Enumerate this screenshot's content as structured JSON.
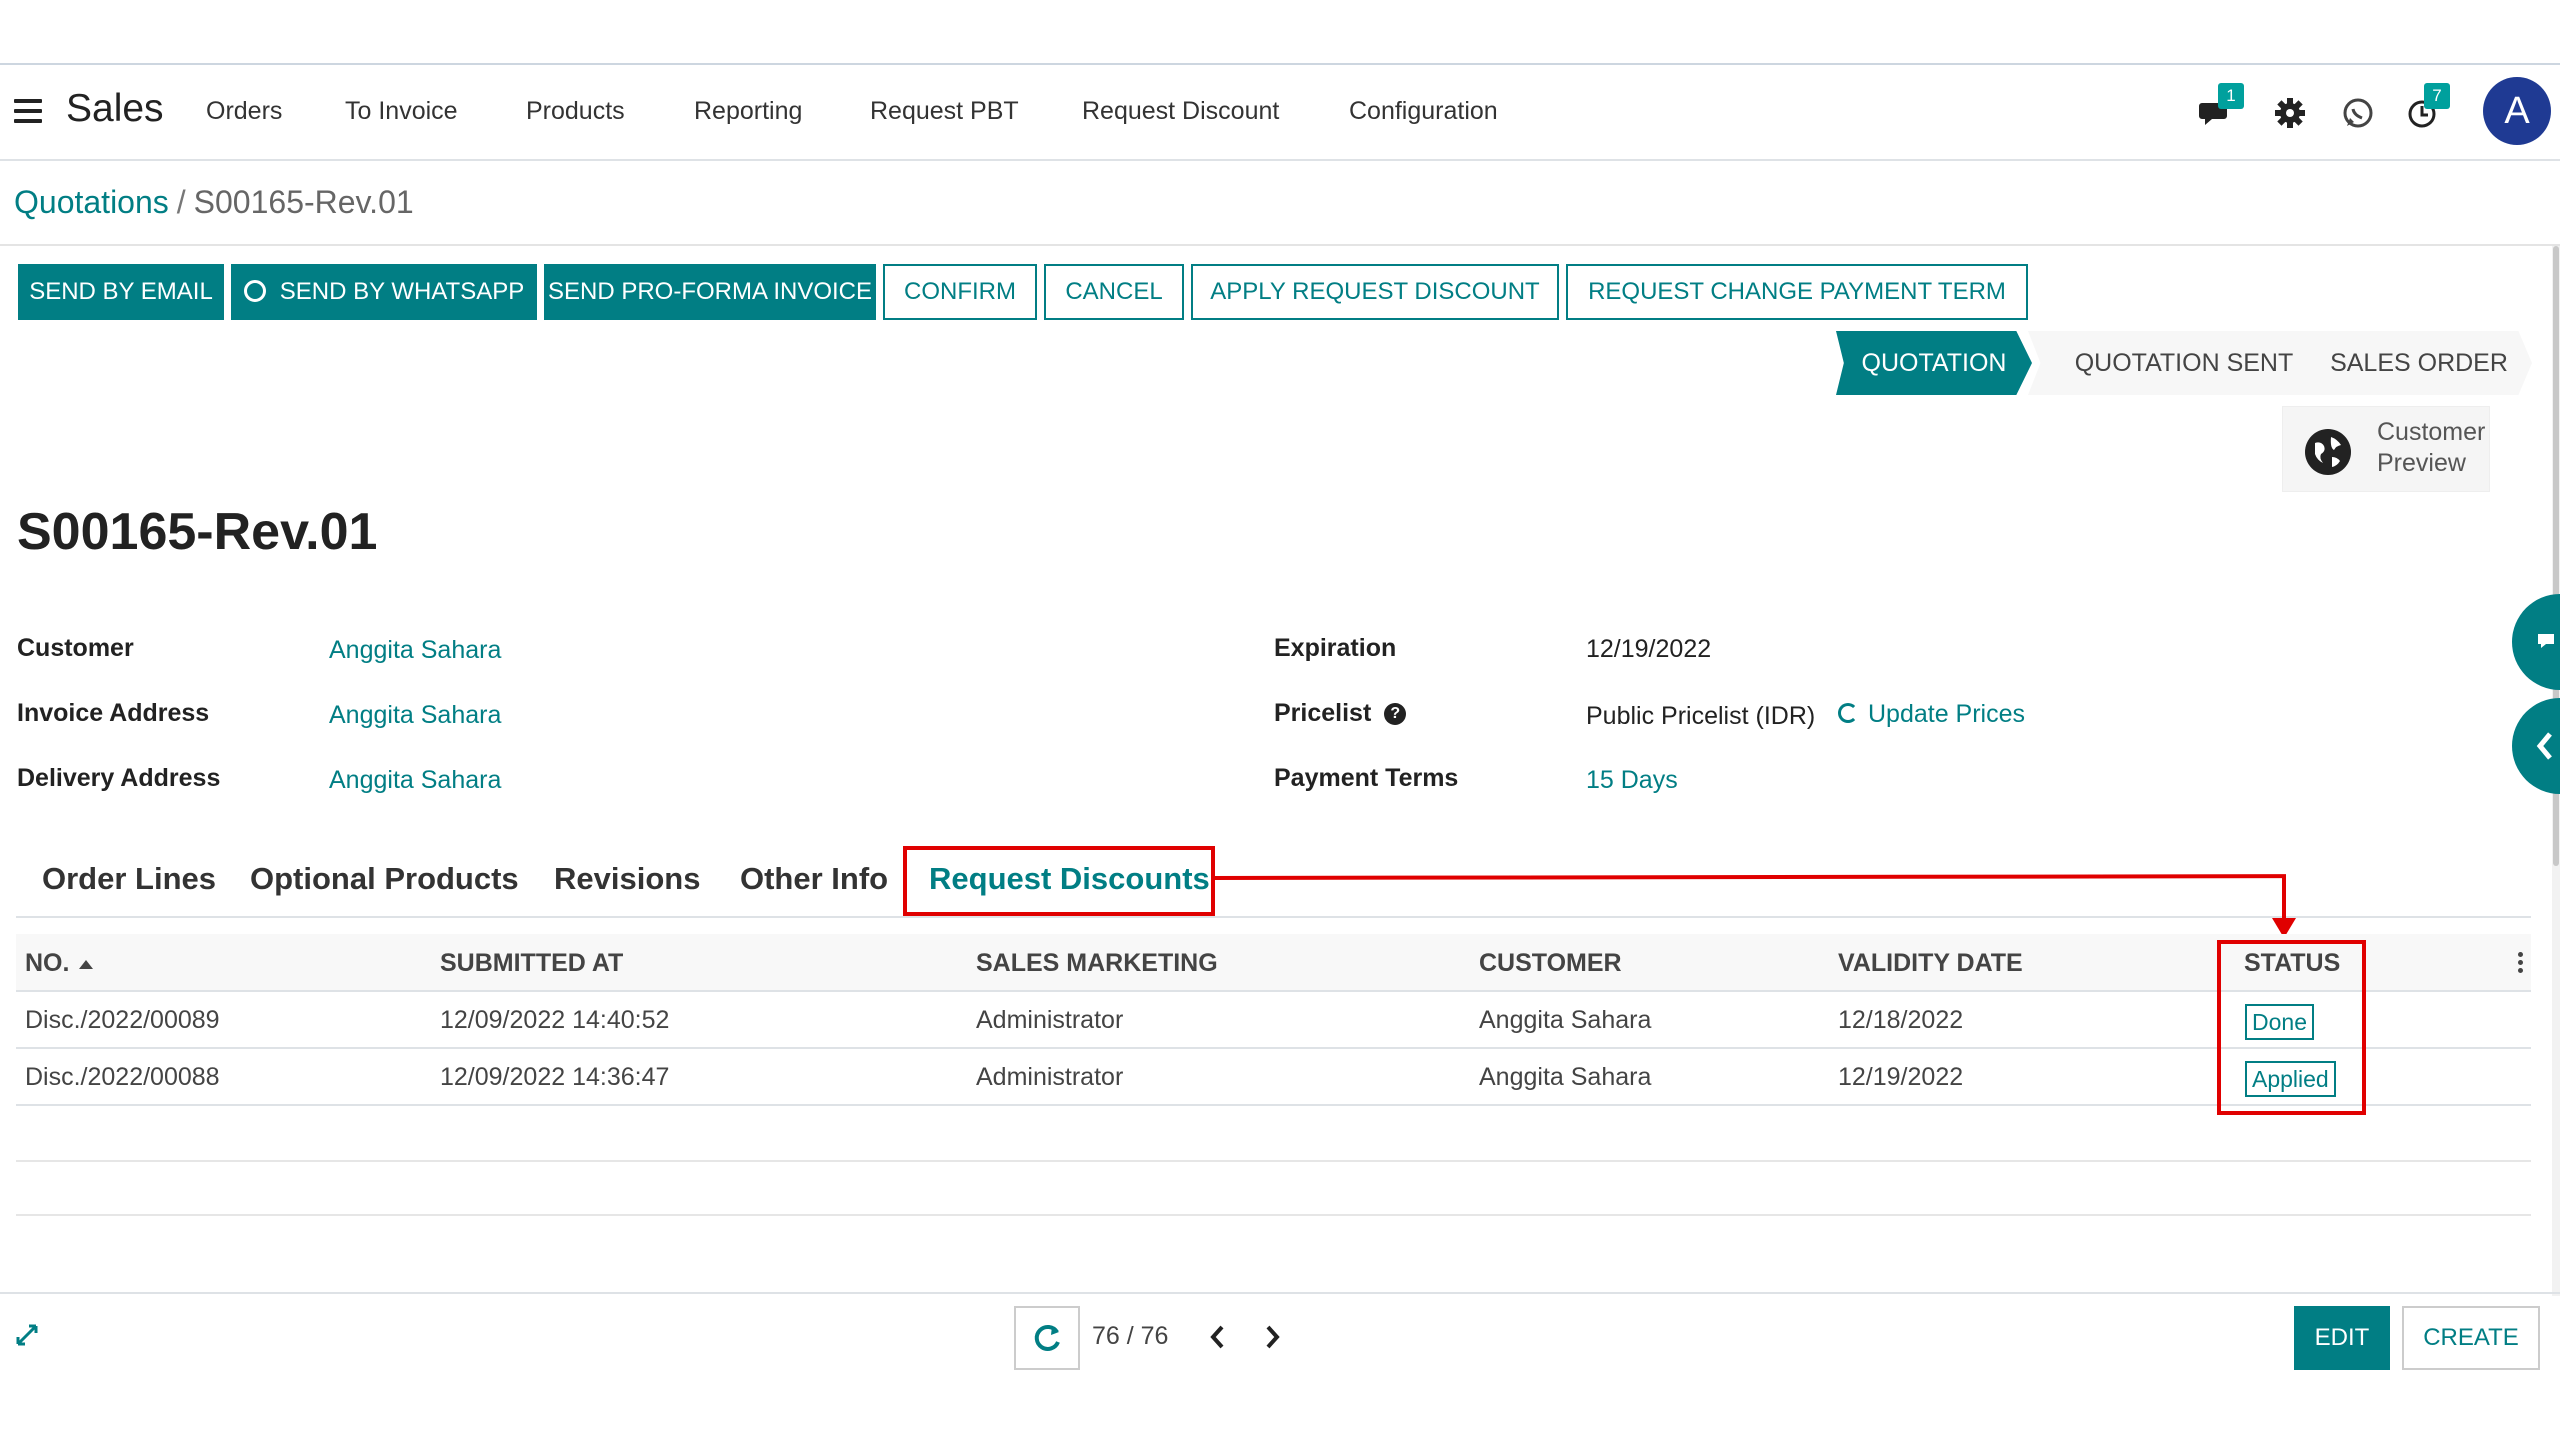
{
  "navbar": {
    "app_title": "Sales",
    "menu": [
      "Orders",
      "To Invoice",
      "Products",
      "Reporting",
      "Request PBT",
      "Request Discount",
      "Configuration"
    ],
    "messages_badge": "1",
    "activities_badge": "7",
    "avatar_letter": "A"
  },
  "breadcrumb": {
    "parent": "Quotations",
    "separator": "/",
    "current": "S00165-Rev.01"
  },
  "actions": {
    "send_email": "SEND BY EMAIL",
    "send_whatsapp": "SEND BY WHATSAPP",
    "send_proforma": "SEND PRO-FORMA INVOICE",
    "confirm": "CONFIRM",
    "cancel": "CANCEL",
    "apply_discount": "APPLY REQUEST DISCOUNT",
    "change_payment_term": "REQUEST CHANGE PAYMENT TERM"
  },
  "status_bar": {
    "stages": [
      "QUOTATION",
      "QUOTATION SENT",
      "SALES ORDER"
    ],
    "active": "QUOTATION"
  },
  "customer_preview": {
    "line1": "Customer",
    "line2": "Preview"
  },
  "record": {
    "title": "S00165-Rev.01"
  },
  "fields": {
    "customer_label": "Customer",
    "customer": "Anggita Sahara",
    "invoice_label": "Invoice Address",
    "invoice": "Anggita Sahara",
    "delivery_label": "Delivery Address",
    "delivery": "Anggita Sahara",
    "expiration_label": "Expiration",
    "expiration": "12/19/2022",
    "pricelist_label": "Pricelist",
    "pricelist_help": "?",
    "pricelist": "Public Pricelist (IDR)",
    "update_prices": "Update Prices",
    "payment_terms_label": "Payment Terms",
    "payment_terms": "15 Days"
  },
  "tabs": [
    "Order Lines",
    "Optional Products",
    "Revisions",
    "Other Info",
    "Request Discounts"
  ],
  "active_tab": "Request Discounts",
  "table": {
    "columns": [
      "NO.",
      "SUBMITTED AT",
      "SALES MARKETING",
      "CUSTOMER",
      "VALIDITY DATE",
      "STATUS"
    ],
    "rows": [
      {
        "no": "Disc./2022/00089",
        "submitted": "12/09/2022 14:40:52",
        "sales": "Administrator",
        "customer": "Anggita Sahara",
        "validity": "12/18/2022",
        "status": "Done"
      },
      {
        "no": "Disc./2022/00088",
        "submitted": "12/09/2022 14:36:47",
        "sales": "Administrator",
        "customer": "Anggita Sahara",
        "validity": "12/19/2022",
        "status": "Applied"
      }
    ]
  },
  "pager": {
    "value": "76 / 76"
  },
  "bottom": {
    "edit": "EDIT",
    "create": "CREATE"
  },
  "colors": {
    "primary": "#017e84",
    "annotation": "#e00000",
    "avatar": "#1f3a93"
  }
}
